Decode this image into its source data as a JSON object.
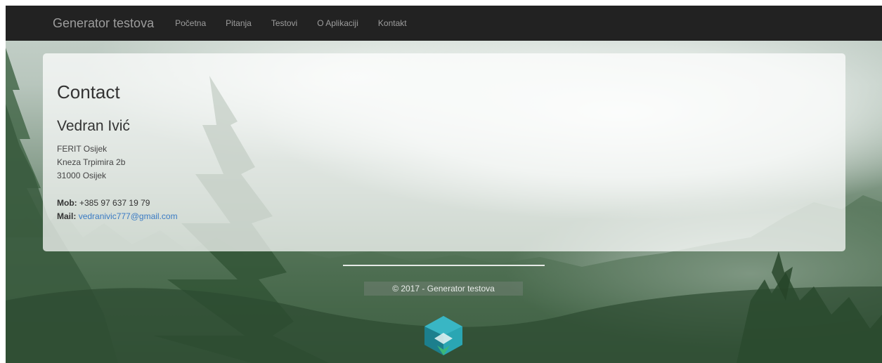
{
  "navbar": {
    "brand": "Generator testova",
    "links": [
      "Početna",
      "Pitanja",
      "Testovi",
      "O Aplikaciji",
      "Kontakt"
    ]
  },
  "contact": {
    "title": "Contact",
    "name": "Vedran Ivić",
    "address": [
      "FERIT Osijek",
      "Kneza Trpimira 2b",
      "31000 Osijek"
    ],
    "mob_label": "Mob:",
    "mob_value": "+385 97 637 19 79",
    "mail_label": "Mail:",
    "mail_value": "vedranivic777@gmail.com"
  },
  "footer": {
    "copyright": "© 2017 - Generator testova",
    "logo_icon": "hexagon-logo-icon"
  },
  "colors": {
    "navbar_bg": "#222222",
    "nav_text": "#9d9d9d",
    "link": "#3a7bc4",
    "logo_teal": "#2aa6b3",
    "logo_green": "#3cb878"
  }
}
